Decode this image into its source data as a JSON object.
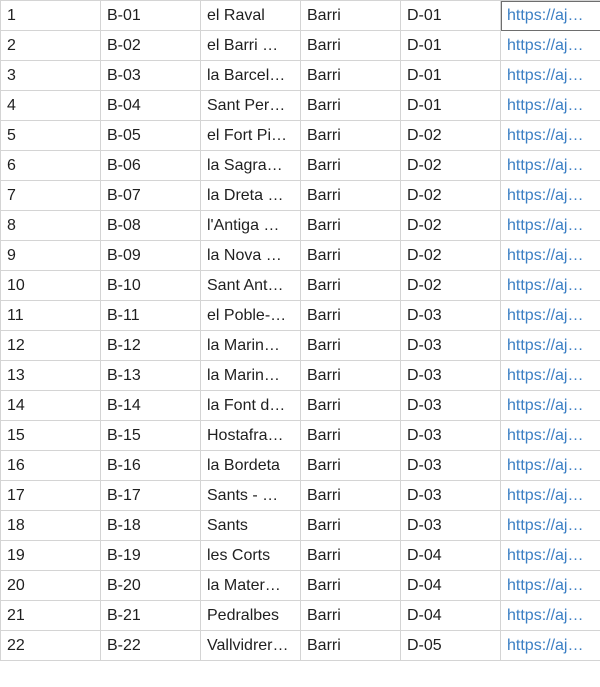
{
  "table": {
    "rows": [
      [
        "1",
        "B-01",
        "el Raval",
        "Barri",
        "D-01",
        "https://aj…"
      ],
      [
        "2",
        "B-02",
        "el Barri …",
        "Barri",
        "D-01",
        "https://aj…"
      ],
      [
        "3",
        "B-03",
        "la Barcel…",
        "Barri",
        "D-01",
        "https://aj…"
      ],
      [
        "4",
        "B-04",
        "Sant Per…",
        "Barri",
        "D-01",
        "https://aj…"
      ],
      [
        "5",
        "B-05",
        "el Fort Pi…",
        "Barri",
        "D-02",
        "https://aj…"
      ],
      [
        "6",
        "B-06",
        "la Sagra…",
        "Barri",
        "D-02",
        "https://aj…"
      ],
      [
        "7",
        "B-07",
        "la Dreta …",
        "Barri",
        "D-02",
        "https://aj…"
      ],
      [
        "8",
        "B-08",
        "l'Antiga …",
        "Barri",
        "D-02",
        "https://aj…"
      ],
      [
        "9",
        "B-09",
        "la Nova …",
        "Barri",
        "D-02",
        "https://aj…"
      ],
      [
        "10",
        "B-10",
        "Sant Ant…",
        "Barri",
        "D-02",
        "https://aj…"
      ],
      [
        "11",
        "B-11",
        "el Poble-…",
        "Barri",
        "D-03",
        "https://aj…"
      ],
      [
        "12",
        "B-12",
        "la Marin…",
        "Barri",
        "D-03",
        "https://aj…"
      ],
      [
        "13",
        "B-13",
        "la Marin…",
        "Barri",
        "D-03",
        "https://aj…"
      ],
      [
        "14",
        "B-14",
        "la Font d…",
        "Barri",
        "D-03",
        "https://aj…"
      ],
      [
        "15",
        "B-15",
        "Hostafra…",
        "Barri",
        "D-03",
        "https://aj…"
      ],
      [
        "16",
        "B-16",
        "la Bordeta",
        "Barri",
        "D-03",
        "https://aj…"
      ],
      [
        "17",
        "B-17",
        "Sants - …",
        "Barri",
        "D-03",
        "https://aj…"
      ],
      [
        "18",
        "B-18",
        "Sants",
        "Barri",
        "D-03",
        "https://aj…"
      ],
      [
        "19",
        "B-19",
        "les Corts",
        "Barri",
        "D-04",
        "https://aj…"
      ],
      [
        "20",
        "B-20",
        "la Mater…",
        "Barri",
        "D-04",
        "https://aj…"
      ],
      [
        "21",
        "B-21",
        "Pedralbes",
        "Barri",
        "D-04",
        "https://aj…"
      ],
      [
        "22",
        "B-22",
        "Vallvidrer…",
        "Barri",
        "D-05",
        "https://aj…"
      ]
    ]
  },
  "colors": {
    "link": "#3b7fc4",
    "grid": "#d4d4d4",
    "text": "#1f1f1f"
  }
}
